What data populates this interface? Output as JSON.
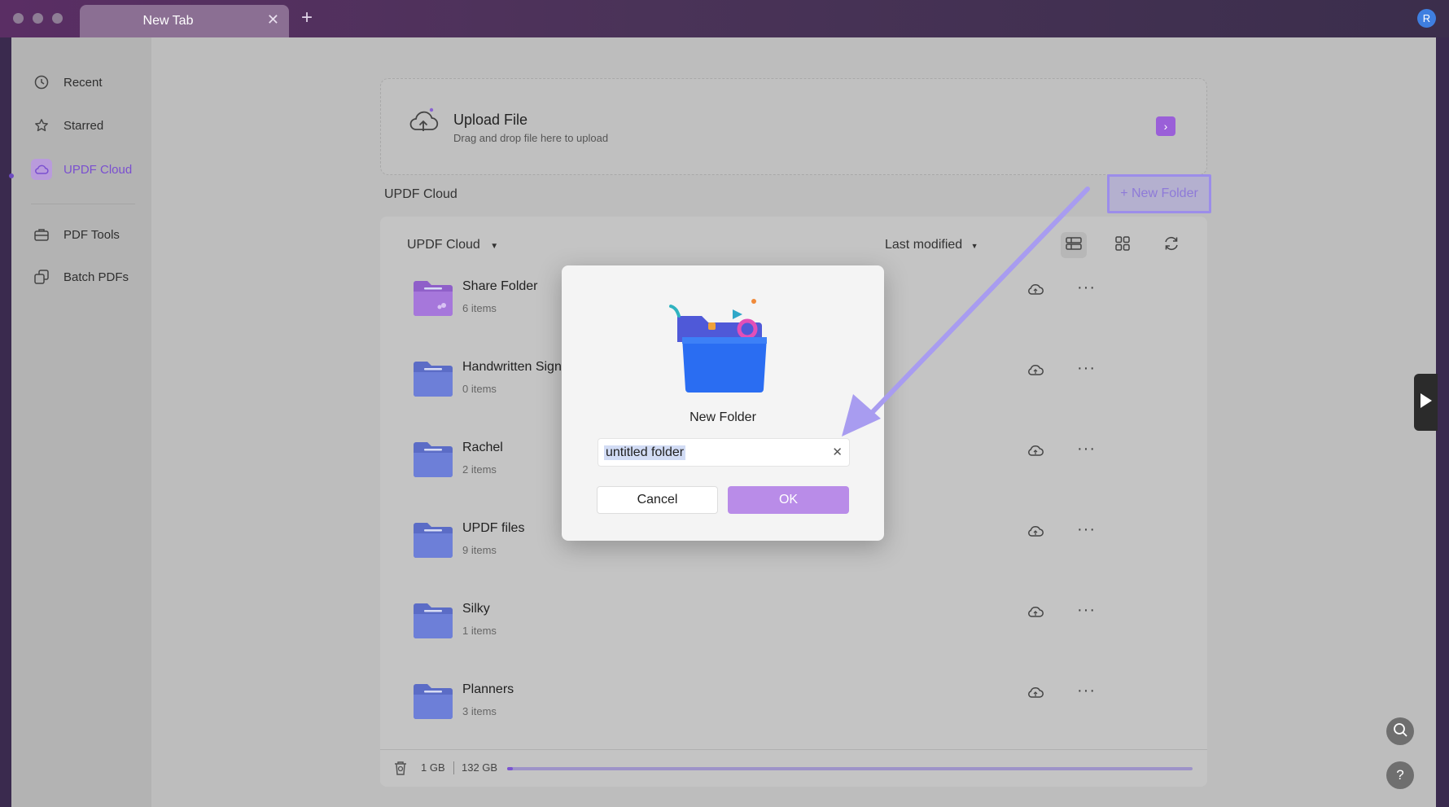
{
  "tab": {
    "title": "New Tab"
  },
  "user": {
    "initial": "R"
  },
  "sidebar": {
    "items": [
      {
        "label": "Recent",
        "icon": "clock-icon"
      },
      {
        "label": "Starred",
        "icon": "star-icon"
      },
      {
        "label": "UPDF Cloud",
        "icon": "cloud-icon",
        "active": true
      },
      {
        "label": "PDF Tools",
        "icon": "toolbox-icon"
      },
      {
        "label": "Batch PDFs",
        "icon": "batch-icon"
      }
    ]
  },
  "upload": {
    "title": "Upload File",
    "subtitle": "Drag and drop file here to upload"
  },
  "section": {
    "label": "UPDF Cloud",
    "new_folder": "+ New Folder"
  },
  "toolbar": {
    "location": "UPDF Cloud",
    "sort": "Last modified"
  },
  "folders": [
    {
      "name": "Share Folder",
      "count": "6 items",
      "shared": true
    },
    {
      "name": "Handwritten Sign",
      "count": "0 items"
    },
    {
      "name": "Rachel",
      "count": "2 items"
    },
    {
      "name": "UPDF files",
      "count": "9 items"
    },
    {
      "name": "Silky",
      "count": "1 items"
    },
    {
      "name": "Planners",
      "count": "3 items"
    }
  ],
  "storage": {
    "used": "1 GB",
    "total": "132 GB",
    "used_fraction": 0.008
  },
  "modal": {
    "title": "New Folder",
    "input_value": "untitled folder",
    "cancel": "Cancel",
    "ok": "OK"
  },
  "colors": {
    "accent": "#7b55d1",
    "ok_button": "#b98ce8",
    "highlight": "#9c8dea"
  }
}
